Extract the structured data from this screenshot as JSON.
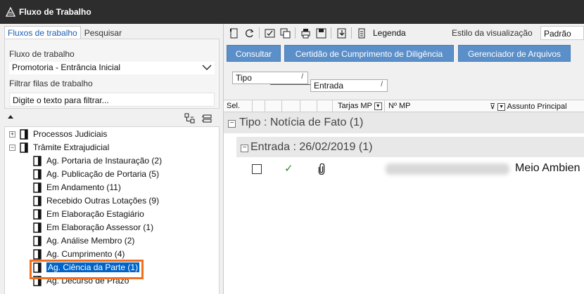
{
  "window": {
    "title": "Fluxo de Trabalho"
  },
  "left_panel": {
    "tabs": [
      {
        "label": "Fluxos de trabalho",
        "active": true
      },
      {
        "label": "Pesquisar",
        "active": false
      }
    ],
    "workflow_label": "Fluxo de trabalho",
    "workflow_value": "Promotoria - Entrância Inicial",
    "filter_label": "Filtrar filas de trabalho",
    "filter_value": "Digite o texto para filtrar...",
    "tree": [
      {
        "label": "Processos Judiciais",
        "level": 0,
        "expander": "+"
      },
      {
        "label": "Trâmite Extrajudicial",
        "level": 0,
        "expander": "-"
      },
      {
        "label": "Ag. Portaria de Instauração (2)",
        "level": 1
      },
      {
        "label": "Ag. Publicação de Portaria (5)",
        "level": 1
      },
      {
        "label": "Em Andamento (11)",
        "level": 1
      },
      {
        "label": "Recebido Outras Lotações (9)",
        "level": 1
      },
      {
        "label": "Em Elaboração Estagiário",
        "level": 1
      },
      {
        "label": "Em Elaboração Assessor (1)",
        "level": 1
      },
      {
        "label": "Ag. Análise Membro (2)",
        "level": 1
      },
      {
        "label": "Ag. Cumprimento (4)",
        "level": 1
      },
      {
        "label": "Ag. Ciência da Parte (1)",
        "level": 1,
        "selected": true
      },
      {
        "label": "Ag. Decurso de Prazo",
        "level": 1
      }
    ]
  },
  "toolbar": {
    "legend_label": "Legenda",
    "view_style_label": "Estilo da visualização",
    "view_style_value": "Padrão"
  },
  "actions": [
    {
      "label": "Consultar"
    },
    {
      "label": "Certidão de Cumprimento de Diligência"
    },
    {
      "label": "Gerenciador de Arquivos"
    }
  ],
  "grouping": {
    "level1": "Tipo",
    "level2": "Entrada"
  },
  "columns": {
    "sel": "Sel.",
    "tarjas": "Tarjas MP",
    "numero": "Nº MP",
    "assunto": "Assunto Principal"
  },
  "groups": {
    "tipo_header": "Tipo : Notícia de Fato  (1)",
    "entrada_header": "Entrada : 26/02/2019  (1)"
  },
  "row": {
    "subject": "Meio Ambien"
  },
  "colors": {
    "titlebar": "#2d2d2d",
    "button": "#5b8fc9",
    "selection": "#0063c7",
    "highlight_box": "#f07020"
  }
}
